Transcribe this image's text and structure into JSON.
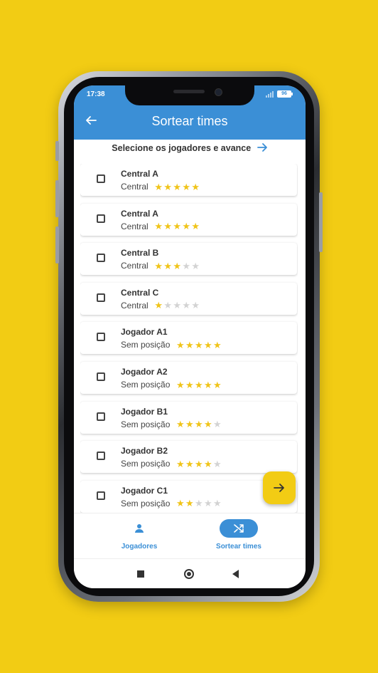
{
  "status_bar": {
    "time": "17:38",
    "battery": "96"
  },
  "app_bar": {
    "title": "Sortear times",
    "back_icon": "arrow-left-icon"
  },
  "instruction": {
    "text": "Selecione os jogadores e avance",
    "icon": "arrow-right-icon"
  },
  "players": [
    {
      "name": "Central A",
      "position": "Central",
      "rating": 5,
      "max_rating": 5,
      "checked": false
    },
    {
      "name": "Central A",
      "position": "Central",
      "rating": 5,
      "max_rating": 5,
      "checked": false
    },
    {
      "name": "Central B",
      "position": "Central",
      "rating": 3,
      "max_rating": 5,
      "checked": false
    },
    {
      "name": "Central C",
      "position": "Central",
      "rating": 1,
      "max_rating": 5,
      "checked": false
    },
    {
      "name": "Jogador A1",
      "position": "Sem posição",
      "rating": 5,
      "max_rating": 5,
      "checked": false
    },
    {
      "name": "Jogador A2",
      "position": "Sem posição",
      "rating": 5,
      "max_rating": 5,
      "checked": false
    },
    {
      "name": "Jogador B1",
      "position": "Sem posição",
      "rating": 4,
      "max_rating": 5,
      "checked": false
    },
    {
      "name": "Jogador B2",
      "position": "Sem posição",
      "rating": 4,
      "max_rating": 5,
      "checked": false
    },
    {
      "name": "Jogador C1",
      "position": "Sem posição",
      "rating": 2,
      "max_rating": 5,
      "checked": false
    }
  ],
  "fab": {
    "icon": "arrow-right-icon"
  },
  "bottom_nav": [
    {
      "label": "Jogadores",
      "icon": "person-icon",
      "active": false
    },
    {
      "label": "Sortear times",
      "icon": "shuffle-icon",
      "active": true
    }
  ],
  "colors": {
    "primary": "#3b8fd6",
    "accent": "#f2cc14",
    "star_on": "#f0c419",
    "star_off": "#d3d3d3"
  }
}
